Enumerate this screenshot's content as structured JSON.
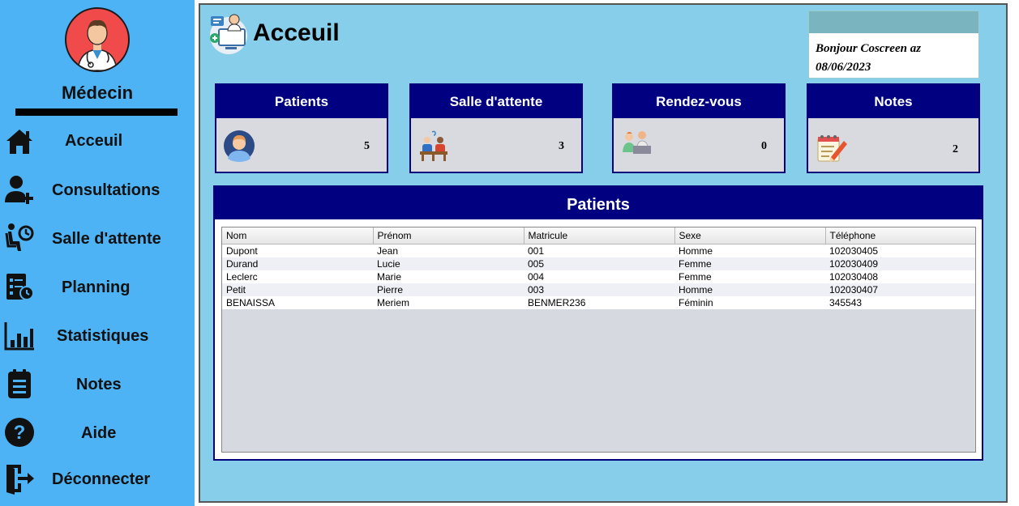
{
  "sidebar": {
    "role": "Médecin",
    "items": [
      {
        "label": "Acceuil",
        "icon": "home-icon"
      },
      {
        "label": "Consultations",
        "icon": "add-user-icon"
      },
      {
        "label": "Salle d'attente",
        "icon": "waiting-room-icon"
      },
      {
        "label": "Planning",
        "icon": "planning-icon"
      },
      {
        "label": "Statistiques",
        "icon": "bar-chart-icon"
      },
      {
        "label": "Notes",
        "icon": "notes-icon"
      },
      {
        "label": "Aide",
        "icon": "help-icon"
      },
      {
        "label": "Déconnecter",
        "icon": "logout-icon"
      }
    ]
  },
  "header": {
    "title": "Acceuil",
    "greeting": "Bonjour Coscreen az",
    "date": "08/06/2023"
  },
  "cards": [
    {
      "title": "Patients",
      "value": "5",
      "icon": "patient-icon"
    },
    {
      "title": "Salle d'attente",
      "value": "3",
      "icon": "waiting-people-icon"
    },
    {
      "title": "Rendez-vous",
      "value": "0",
      "icon": "appointment-icon"
    },
    {
      "title": "Notes",
      "value": "2",
      "icon": "notepad-icon"
    }
  ],
  "patients_panel": {
    "title": "Patients",
    "columns": [
      "Nom",
      "Prénom",
      "Matricule",
      "Sexe",
      "Téléphone"
    ],
    "rows": [
      [
        "Dupont",
        "Jean",
        "001",
        "Homme",
        "102030405"
      ],
      [
        "Durand",
        "Lucie",
        "005",
        "Femme",
        "102030409"
      ],
      [
        "Leclerc",
        "Marie",
        "004",
        "Femme",
        "102030408"
      ],
      [
        "Petit",
        "Pierre",
        "003",
        "Homme",
        "102030407"
      ],
      [
        "BENAISSA",
        "Meriem",
        "BENMER236",
        "Féminin",
        "345543"
      ]
    ]
  },
  "colors": {
    "sidebar": "#4db3f5",
    "main_bg": "#87ceeb",
    "header_navy": "#000080",
    "card_body": "#d8dae0"
  }
}
